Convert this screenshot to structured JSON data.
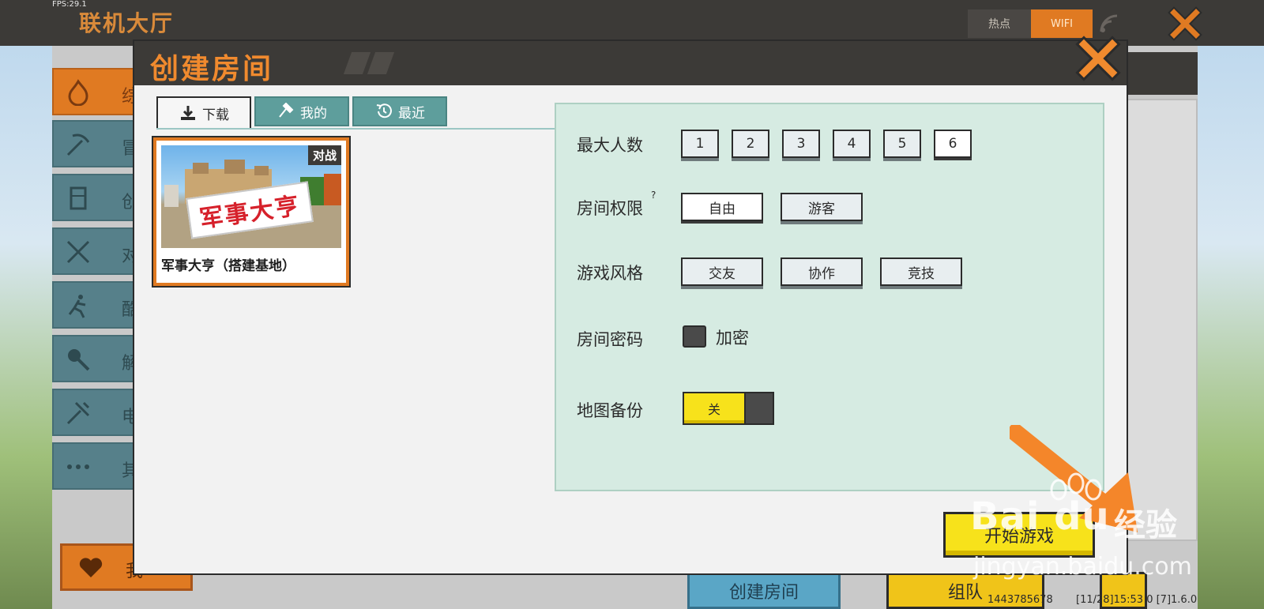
{
  "fps": "FPS:29.1",
  "lobby": {
    "title": "联机大厅",
    "tabs": [
      "热点",
      "WIFI"
    ],
    "side_menu": [
      "综",
      "冒",
      "创",
      "对",
      "酷",
      "解",
      "电",
      "其"
    ],
    "favorite_label": "我",
    "create_room_label": "创建房间",
    "join_label": "组队",
    "footer_id": "1443785678",
    "footer_version": "[11/28]15:53 0 [7]1.6.0"
  },
  "modal": {
    "title": "创建房间",
    "tabs": [
      {
        "label": "下载",
        "icon": "download-icon",
        "active": true
      },
      {
        "label": "我的",
        "icon": "hammer-icon",
        "active": false
      },
      {
        "label": "最近",
        "icon": "history-icon",
        "active": false
      }
    ],
    "map_card": {
      "tag": "对战",
      "thumb_text": "军事大亨",
      "title": "军事大亨（搭建基地）"
    },
    "settings": {
      "max_players": {
        "label": "最大人数",
        "options": [
          "1",
          "2",
          "3",
          "4",
          "5",
          "6"
        ],
        "selected": "6"
      },
      "permission": {
        "label": "房间权限",
        "help": "?",
        "options": [
          "自由",
          "游客"
        ],
        "selected": "自由"
      },
      "style": {
        "label": "游戏风格",
        "options": [
          "交友",
          "协作",
          "竞技"
        ]
      },
      "password": {
        "label": "房间密码",
        "checkbox_label": "加密",
        "checked": false
      },
      "backup": {
        "label": "地图备份",
        "toggle_label": "关",
        "on": false
      }
    },
    "start_button": "开始游戏"
  },
  "watermark": {
    "brand": "Bai du",
    "cn": "经验",
    "sub": "jingyan.baidu.com"
  },
  "colors": {
    "accent": "#e07a22",
    "header": "#3c3a37",
    "teal_tab": "#5e9e9c",
    "yellow": "#f7e21b",
    "panel": "#d6ebe2"
  }
}
